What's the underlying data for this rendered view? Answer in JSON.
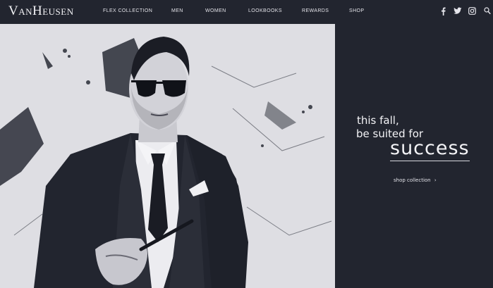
{
  "brand": {
    "logo_text": "VanHeusen"
  },
  "nav": {
    "items": [
      {
        "label": "FLEX COLLECTION"
      },
      {
        "label": "MEN"
      },
      {
        "label": "WOMEN"
      },
      {
        "label": "LOOKBOOKS"
      },
      {
        "label": "REWARDS"
      },
      {
        "label": "SHOP"
      }
    ]
  },
  "social": {
    "icons": [
      "facebook-icon",
      "twitter-icon",
      "instagram-icon",
      "search-icon"
    ]
  },
  "hero": {
    "headline_line1": "this fall,",
    "headline_line2": "be suited for",
    "headline_emphasis": "success",
    "cta_label": "shop collection",
    "cta_arrow": "›"
  },
  "colors": {
    "background": "#22252f",
    "photo_light": "#dedee3",
    "text": "#f3f3f6"
  }
}
